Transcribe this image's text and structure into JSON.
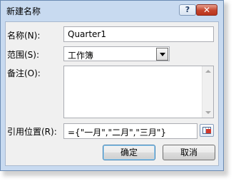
{
  "window": {
    "title": "新建名称",
    "help_label": "?",
    "close_label": "✕"
  },
  "form": {
    "name_label": "名称(N):",
    "name_value": "Quarter1",
    "scope_label": "范围(S):",
    "scope_value": "工作簿",
    "comment_label": "备注(O):",
    "comment_value": "",
    "refers_label": "引用位置(R):",
    "refers_value": "={\"一月\",\"二月\",\"三月\"}"
  },
  "buttons": {
    "ok": "确定",
    "cancel": "取消"
  }
}
